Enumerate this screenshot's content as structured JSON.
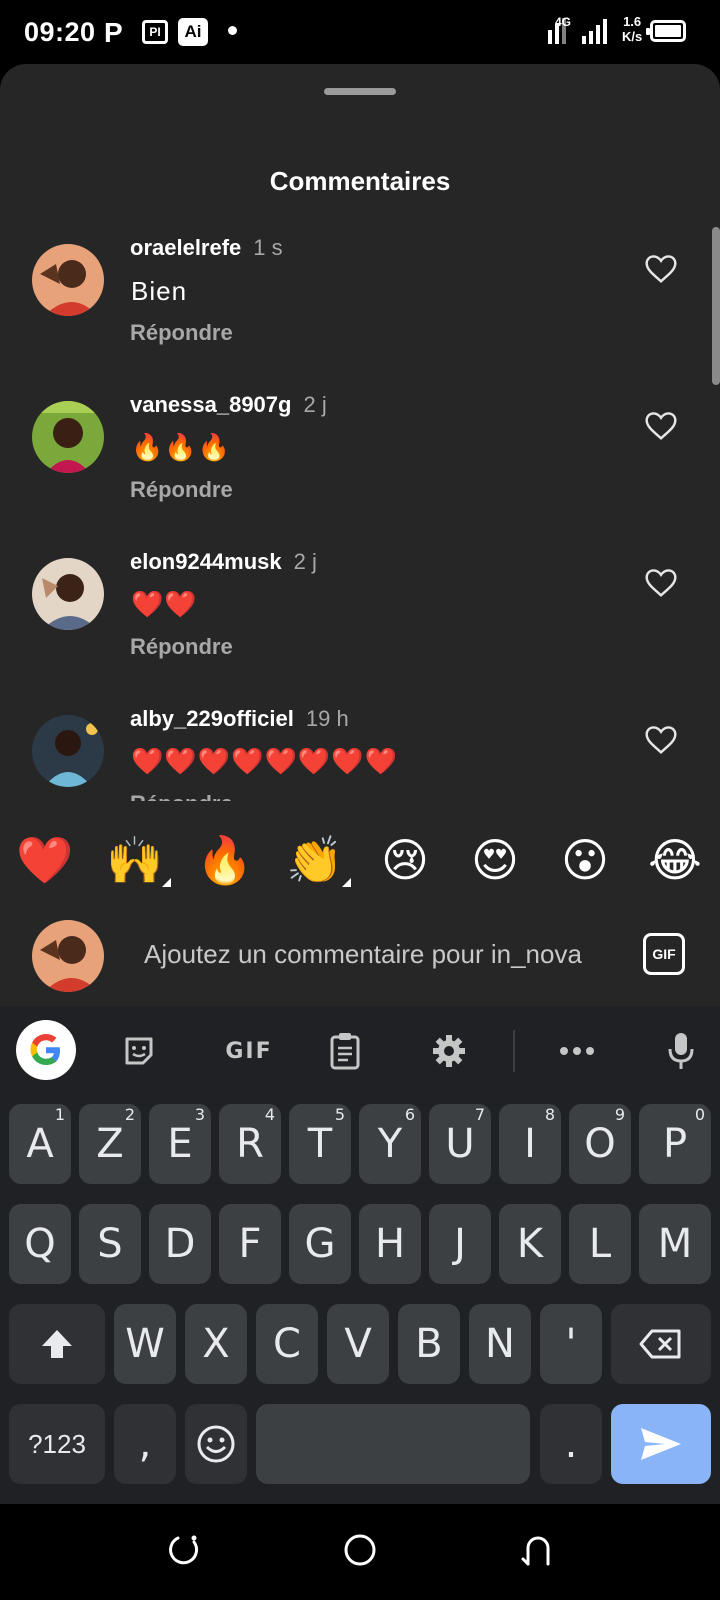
{
  "status_bar": {
    "time": "09:20",
    "network": "4G",
    "speed_value": "1.6",
    "speed_unit": "K/s",
    "app_icons": [
      "parking-app-icon",
      "pi-app-icon",
      "ai-app-icon"
    ]
  },
  "sheet": {
    "title": "Commentaires"
  },
  "comments": [
    {
      "username": "oraelelrefe",
      "time": "1 s",
      "text": "Bien",
      "reply_label": "Répondre",
      "avatar_bg": "#d98c5f"
    },
    {
      "username": "vanessa_8907g",
      "time": "2 j",
      "text": "🔥🔥🔥",
      "reply_label": "Répondre",
      "avatar_bg": "#7aa83a"
    },
    {
      "username": "elon9244musk",
      "time": "2 j",
      "text": "❤️❤️",
      "reply_label": "Répondre",
      "avatar_bg": "#c9b39e"
    },
    {
      "username": "alby_229officiel",
      "time": "19 h",
      "text": "❤️❤️❤️❤️❤️❤️❤️❤️",
      "reply_label": "Répondre",
      "avatar_bg": "#3a4a5a"
    }
  ],
  "reactions": [
    "❤️",
    "🙌",
    "🔥",
    "👏",
    "😢",
    "😍",
    "😮",
    "😂"
  ],
  "comment_input": {
    "placeholder": "Ajoutez un commentaire pour in_nova",
    "gif_label": "GIF"
  },
  "keyboard": {
    "toolbar_gif": "GIF",
    "row1": [
      "A",
      "Z",
      "E",
      "R",
      "T",
      "Y",
      "U",
      "I",
      "O",
      "P"
    ],
    "row1_hints": [
      "1",
      "2",
      "3",
      "4",
      "5",
      "6",
      "7",
      "8",
      "9",
      "0"
    ],
    "row2": [
      "Q",
      "S",
      "D",
      "F",
      "G",
      "H",
      "J",
      "K",
      "L",
      "M"
    ],
    "row3": [
      "W",
      "X",
      "C",
      "V",
      "B",
      "N",
      "'"
    ],
    "symbols_label": "?123",
    "comma": ",",
    "period": "."
  },
  "colors": {
    "sheet_bg": "#262626",
    "keyboard_bg": "#202124",
    "key_bg": "#3c4043",
    "enter_key": "#8ab4f8",
    "heart_red": "#e0242f"
  }
}
